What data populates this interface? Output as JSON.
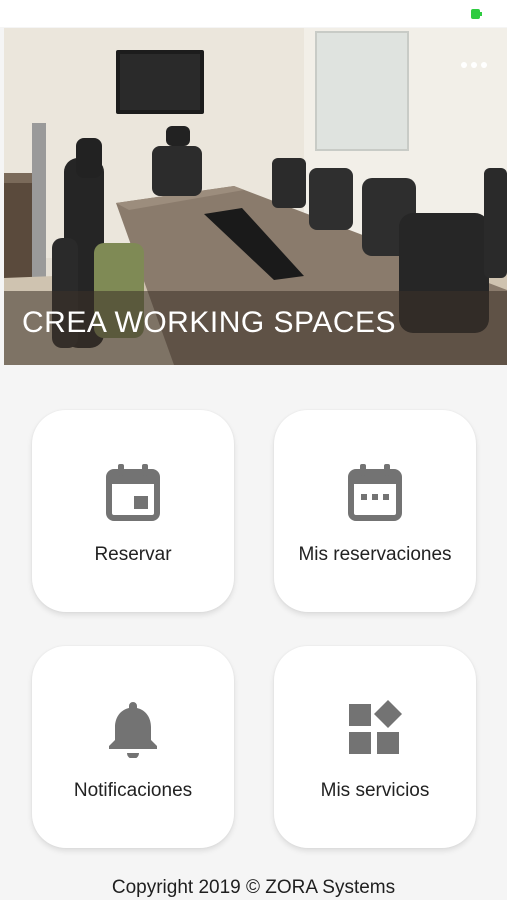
{
  "hero": {
    "title": "CREA WORKING SPACES",
    "image": "meeting-room-photo"
  },
  "tiles": [
    {
      "label": "Reservar",
      "icon": "calendar-icon"
    },
    {
      "label": "Mis reservaciones",
      "icon": "calendar-dots-icon"
    },
    {
      "label": "Notificaciones",
      "icon": "bell-icon"
    },
    {
      "label": "Mis servicios",
      "icon": "widgets-icon"
    }
  ],
  "footer": {
    "copyright": "Copyright 2019 © ZORA Systems"
  },
  "colors": {
    "icon": "#737373",
    "background": "#f5f5f5",
    "tile": "#ffffff",
    "status_battery": "#2ecc40"
  }
}
